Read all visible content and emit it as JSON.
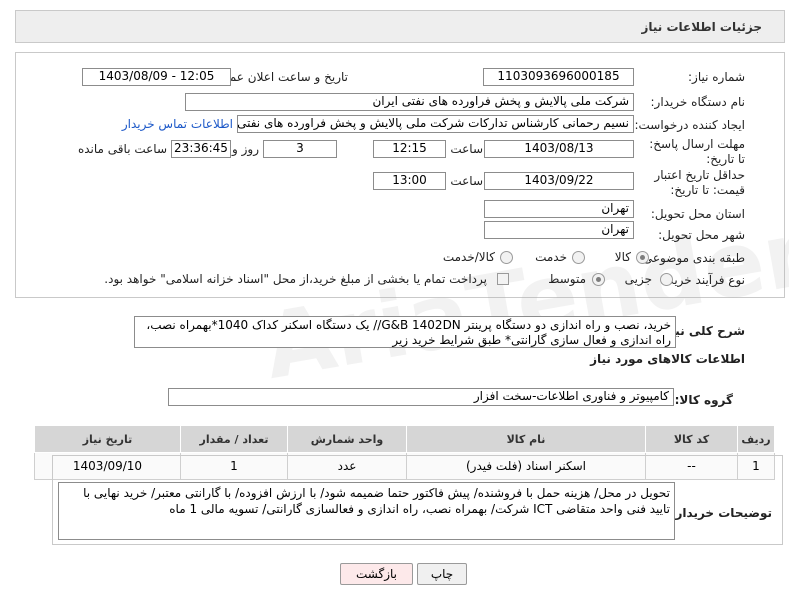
{
  "header": {
    "title": "جزئیات اطلاعات نیاز"
  },
  "form": {
    "need_number_label": "شماره نیاز:",
    "need_number": "1103093696000185",
    "announce_label": "تاریخ و ساعت اعلان عمومی:",
    "announce_value": "1403/08/09 - 12:05",
    "buyer_org_label": "نام دستگاه خریدار:",
    "buyer_org": "شرکت ملی پالایش و پخش فراورده های نفتی ایران",
    "creator_label": "ایجاد کننده درخواست:",
    "creator": "نسیم رحمانی کارشناس تدارکات شرکت ملی پالایش و پخش فراورده های نفتی",
    "contact_link": "اطلاعات تماس خریدار",
    "deadline_label": "مهلت ارسال پاسخ: تا تاریخ:",
    "deadline_date": "1403/08/13",
    "time_label": "ساعت",
    "deadline_time": "12:15",
    "days_value": "3",
    "days_label": "روز و",
    "remaining_time": "23:36:45",
    "remaining_label": "ساعت باقی مانده",
    "validity_label": "حداقل تاریخ اعتبار قیمت: تا تاریخ:",
    "validity_date": "1403/09/22",
    "validity_time_label": "ساعت",
    "validity_time": "13:00",
    "province_label": "استان محل تحویل:",
    "province": "تهران",
    "city_label": "شهر محل تحویل:",
    "city": "تهران",
    "category_label": "طبقه بندی موضوعی:",
    "category_options": [
      "کالا",
      "خدمت",
      "کالا/خدمت"
    ],
    "process_label": "نوع فرآیند خرید :",
    "process_options": [
      "جزیی",
      "متوسط"
    ],
    "payment_note": "پرداخت تمام یا بخشی از مبلغ خرید،از محل \"اسناد خزانه اسلامی\" خواهد بود."
  },
  "description": {
    "label": "شرح کلی نیاز:",
    "text": "خرید، نصب و راه اندازی دو دستگاه پرینتر G&B 1402DN// یک دستگاه اسکنر کداک 1040*بهمراه نصب، راه اندازی و فعال سازی گارانتی* طبق شرایط خرید زیر"
  },
  "goods_section": {
    "title": "اطلاعات کالاهای مورد نیاز",
    "group_label": "گروه کالا:",
    "group_value": "کامپیوتر و فناوری اطلاعات-سخت افزار"
  },
  "table": {
    "headers": [
      "ردیف",
      "کد کالا",
      "نام کالا",
      "واحد شمارش",
      "تعداد / مقدار",
      "تاریخ نیاز"
    ],
    "rows": [
      [
        "1",
        "--",
        "اسکنر اسناد (فلت فیدر)",
        "عدد",
        "1",
        "1403/09/10"
      ]
    ]
  },
  "buyer_notes": {
    "label": "توضیحات خریدار:",
    "text": "تحویل در محل/ هزینه حمل با فروشنده/ پیش فاکتور حتما ضمیمه شود/ با ارزش افزوده/ با گارانتی معتبر/ خرید نهایی با تایید فنی واحد متقاضی ICT شرکت/ بهمراه نصب، راه اندازی و فعالسازی گارانتی/ تسویه مالی 1 ماه"
  },
  "buttons": {
    "print": "چاپ",
    "back": "بازگشت"
  },
  "watermark": "AriaTender.neT",
  "colors": {
    "link": "#1c58c8",
    "panel": "#eeeeee",
    "back_button": "#fde9ea"
  }
}
